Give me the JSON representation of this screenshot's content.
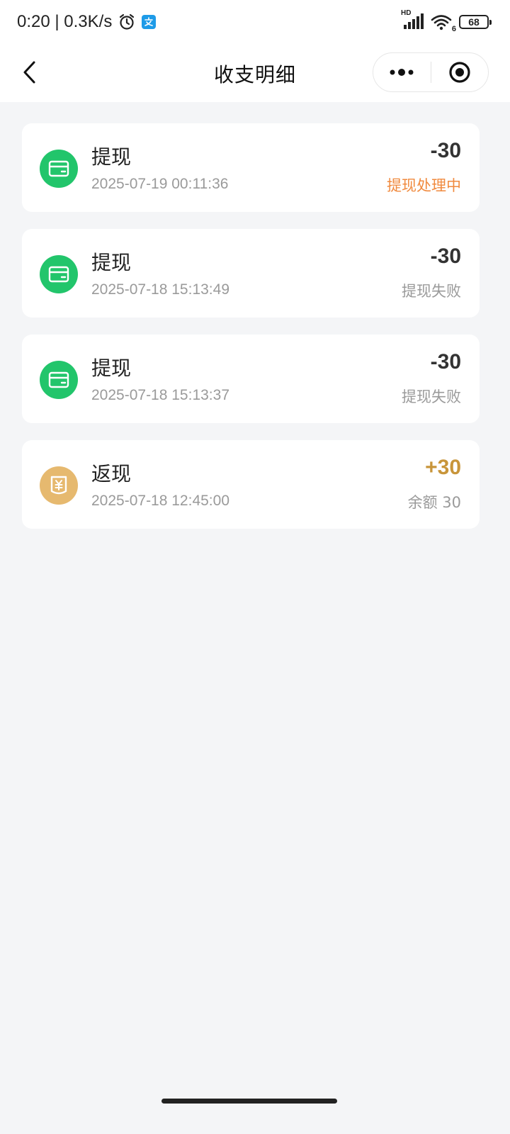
{
  "status_bar": {
    "time_speed": "0:20 | 0.3K/s",
    "signal_label": "HD",
    "wifi_label": "6",
    "battery": "68"
  },
  "nav": {
    "title": "收支明细"
  },
  "colors": {
    "withdraw_icon_bg": "#22c56b",
    "cashback_icon_bg": "#e6b96f",
    "processing_status": "#f08a3e",
    "failed_status": "#9a9a9a",
    "amount_negative": "#333333",
    "amount_positive": "#c8953a"
  },
  "transactions": [
    {
      "icon": "card-icon",
      "title": "提现",
      "time": "2025-07-19 00:11:36",
      "amount": "-30",
      "status": "提现处理中",
      "status_type": "processing"
    },
    {
      "icon": "card-icon",
      "title": "提现",
      "time": "2025-07-18 15:13:49",
      "amount": "-30",
      "status": "提现失败",
      "status_type": "failed"
    },
    {
      "icon": "card-icon",
      "title": "提现",
      "time": "2025-07-18 15:13:37",
      "amount": "-30",
      "status": "提现失败",
      "status_type": "failed"
    },
    {
      "icon": "yuan-wallet-icon",
      "title": "返现",
      "time": "2025-07-18 12:45:00",
      "amount": "+30",
      "status": "余额 30",
      "status_type": "balance"
    }
  ]
}
